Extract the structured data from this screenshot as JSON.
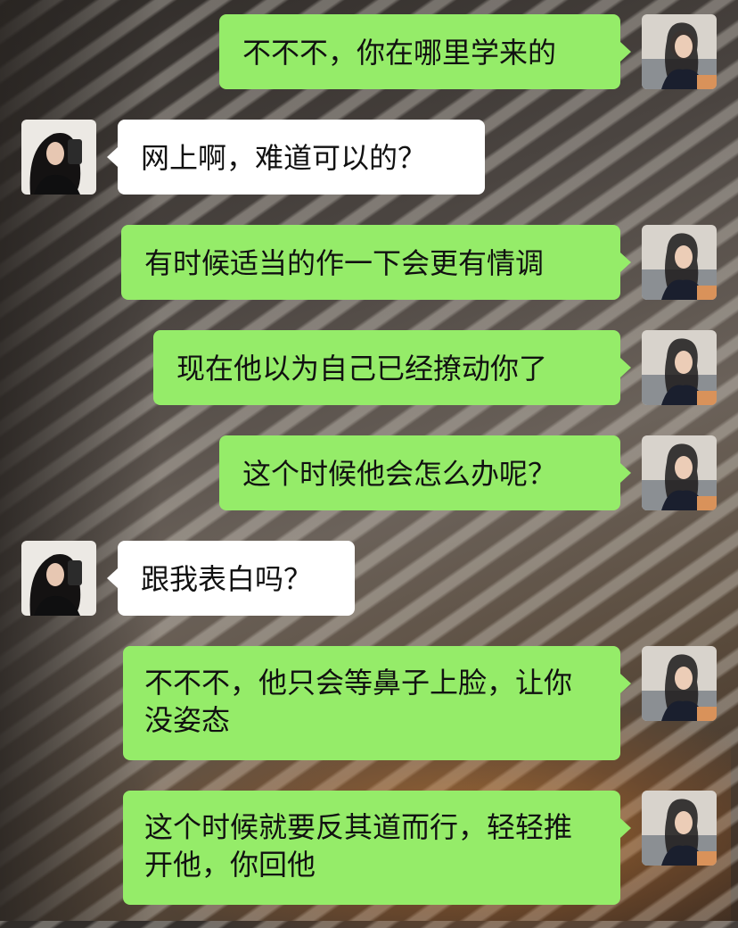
{
  "messages": [
    {
      "side": "right",
      "text": "不不不，你在哪里学来的"
    },
    {
      "side": "left",
      "text": "网上啊，难道可以的？"
    },
    {
      "side": "right",
      "text": "有时候适当的作一下会更有情调"
    },
    {
      "side": "right",
      "text": "现在他以为自己已经撩动你了"
    },
    {
      "side": "right",
      "text": "这个时候他会怎么办呢？"
    },
    {
      "side": "left",
      "text": "跟我表白吗？"
    },
    {
      "side": "right",
      "text": "不不不，他只会等鼻子上脸，让你没姿态"
    },
    {
      "side": "right",
      "text": "这个时候就要反其道而行，轻轻推开他，你回他"
    }
  ],
  "avatars": {
    "self": "user-avatar-icon",
    "other": "contact-avatar-icon"
  },
  "colors": {
    "self_bubble": "#95ec69",
    "other_bubble": "#ffffff"
  }
}
